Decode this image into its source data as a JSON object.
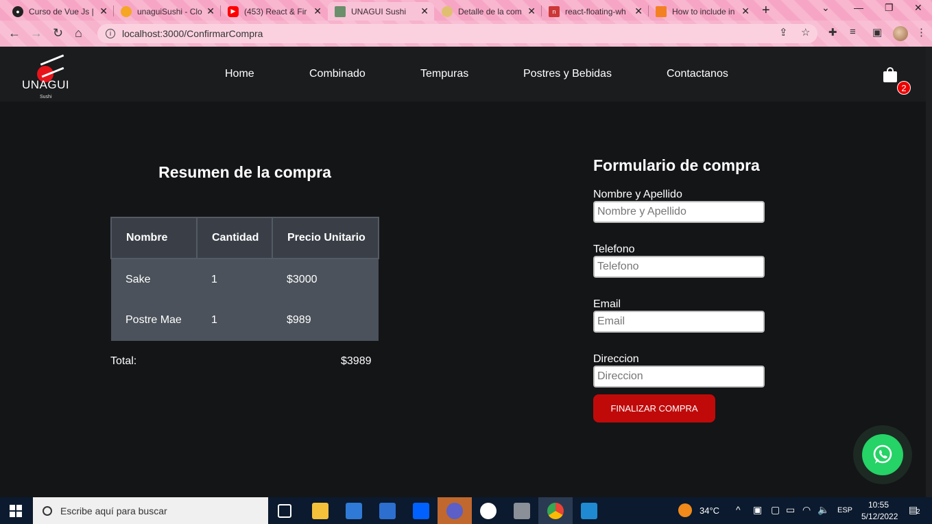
{
  "browser": {
    "tabs": [
      {
        "title": "Curso de Vue Js |",
        "icon": "vue-course-icon",
        "icon_color": "#222222"
      },
      {
        "title": "unaguiSushi - Clo",
        "icon": "cloud-functions-icon",
        "icon_color": "#f5a623"
      },
      {
        "title": "(453) React & Fir",
        "icon": "youtube-icon",
        "icon_color": "#ff0000"
      },
      {
        "title": "UNAGUI Sushi",
        "icon": "site-favicon",
        "icon_color": "#6b8e6b"
      },
      {
        "title": "Detalle de la com",
        "icon": "sushi-favicon",
        "icon_color": "#e0c070"
      },
      {
        "title": "react-floating-wh",
        "icon": "npm-icon",
        "icon_color": "#cb3837"
      },
      {
        "title": "How to include in",
        "icon": "stackoverflow-icon",
        "icon_color": "#f48024"
      }
    ],
    "new_tab": "+",
    "url": "localhost:3000/ConfirmarCompra"
  },
  "site": {
    "logo_text": "UNAGUI",
    "logo_sub": "Sushi",
    "nav": [
      "Home",
      "Combinado",
      "Tempuras",
      "Postres y Bebidas",
      "Contactanos"
    ],
    "cart_count": "2"
  },
  "summary": {
    "title": "Resumen de la compra",
    "headers": [
      "Nombre",
      "Cantidad",
      "Precio Unitario"
    ],
    "rows": [
      [
        "Sake",
        "1",
        "$3000"
      ],
      [
        "Postre Mae",
        "1",
        "$989"
      ]
    ],
    "total_label": "Total:",
    "total_value": "$3989"
  },
  "form": {
    "title": "Formulario de compra",
    "fields": [
      {
        "label": "Nombre y Apellido",
        "placeholder": "Nombre y Apellido",
        "value": ""
      },
      {
        "label": "Telefono",
        "placeholder": "Telefono",
        "value": ""
      },
      {
        "label": "Email",
        "placeholder": "Email",
        "value": ""
      },
      {
        "label": "Direccion",
        "placeholder": "Direccion",
        "value": ""
      }
    ],
    "submit_label": "FINALIZAR COMPRA"
  },
  "whatsapp": {
    "icon": "whatsapp-icon",
    "color": "#25d366"
  },
  "taskbar": {
    "search_placeholder": "Escribe aquí para buscar",
    "weather": "34°C",
    "language": "ESP",
    "time": "10:55",
    "date": "5/12/2022",
    "notifications": "2"
  },
  "colors": {
    "accent": "#c00a0a",
    "badge": "#ee0000",
    "background": "#141517"
  }
}
